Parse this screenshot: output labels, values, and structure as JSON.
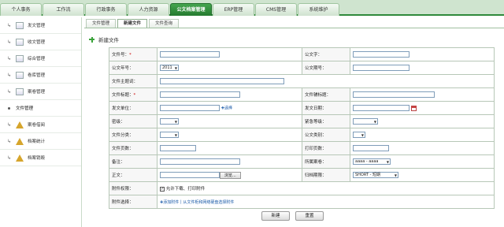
{
  "nav": {
    "tabs": [
      {
        "label": "个人事务"
      },
      {
        "label": "工作流"
      },
      {
        "label": "行政事务"
      },
      {
        "label": "人力资源"
      },
      {
        "label": "公文档案管理"
      },
      {
        "label": "ERP管理"
      },
      {
        "label": "CMS管理"
      },
      {
        "label": "系统维护"
      }
    ],
    "active_index": 4
  },
  "sidebar": {
    "items": [
      {
        "label": "发文管理",
        "icon": "document-icon"
      },
      {
        "label": "收文管理",
        "icon": "document-icon"
      },
      {
        "label": "综合管理",
        "icon": "document-icon"
      },
      {
        "label": "卷库管理",
        "icon": "document-icon"
      },
      {
        "label": "案卷管理",
        "icon": "document-icon"
      },
      {
        "label": "文件管理",
        "icon": "bullet-icon"
      },
      {
        "label": "案卷借阅",
        "icon": "chart-icon"
      },
      {
        "label": "档案统计",
        "icon": "chart-icon"
      },
      {
        "label": "档案销毁",
        "icon": "chart-icon"
      }
    ],
    "active_index": 5
  },
  "subtabs": {
    "items": [
      {
        "label": "文件管理"
      },
      {
        "label": "新建文件"
      },
      {
        "label": "文件查询"
      }
    ],
    "active_index": 1
  },
  "heading": "新建文件",
  "form": {
    "file_no_label": "文件号：",
    "file_no_required": "*",
    "doc_char_label": "公文字：",
    "year_label": "公文年号：",
    "year_value": "2011",
    "issue_no_label": "公文期号：",
    "subject_label": "文件主题词：",
    "title_label": "文件标题：",
    "title_required": "*",
    "aux_title_label": "文件辅标题：",
    "issuer_label": "发文单位：",
    "select_link": "选择",
    "issue_date_label": "发文日期：",
    "secret_label": "密级：",
    "urgency_label": "紧急等级：",
    "category_label": "文件分类：",
    "doc_category_label": "公文类别：",
    "pages_label": "文件页数：",
    "print_pages_label": "打印页数：",
    "remark_label": "备注：",
    "archive_label": "所属案卷：",
    "archive_value": "aaaa - aaaa",
    "body_label": "正文：",
    "browse_label": "浏览...",
    "retention_label": "归档期限：",
    "retention_value": "SHORT - 短期",
    "perm_label": "附件权限：",
    "perm_checkbox_label": "允许下载、打印附件",
    "attach_label": "附件选择：",
    "add_attach_link": "添加附件",
    "divider": "|",
    "from_disk_link": "从文件柜和网络硬盘选择附件"
  },
  "actions": {
    "create": "新建",
    "reset": "重置"
  },
  "colors": {
    "accent": "#2f8a3b",
    "active_tab": "#3a9b44",
    "required": "#cc0000",
    "link": "#1a5aa8"
  }
}
